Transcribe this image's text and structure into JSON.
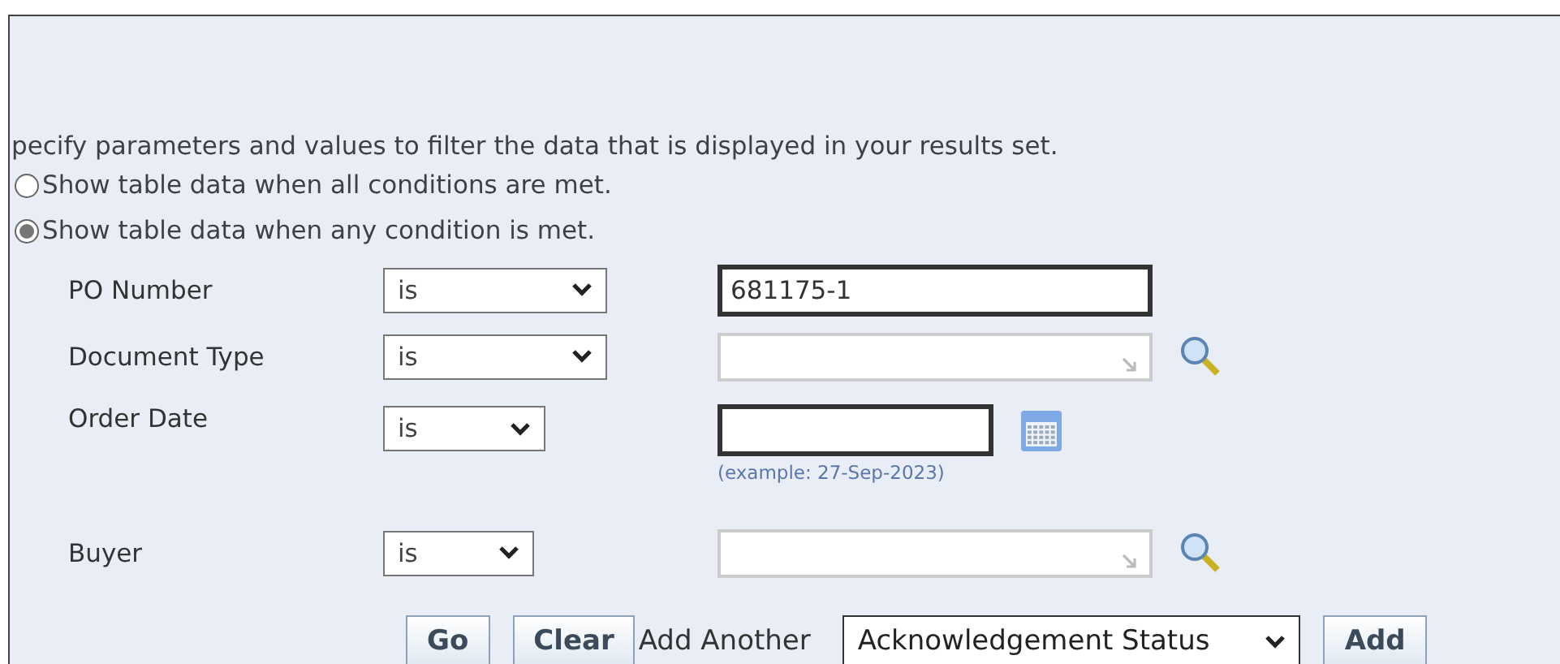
{
  "instructions": "pecify parameters and values to filter the data that is displayed in your results set.",
  "match_options": [
    {
      "label": "Show table data when all conditions are met.",
      "selected": false
    },
    {
      "label": "Show table data when any condition is met.",
      "selected": true
    }
  ],
  "conditions": [
    {
      "label": "PO Number",
      "operator": "is",
      "kind": "text",
      "value": "681175-1",
      "focused": true
    },
    {
      "label": "Document Type",
      "operator": "is",
      "kind": "lov",
      "focused": false
    },
    {
      "label": "Order Date",
      "operator": "is",
      "kind": "date",
      "focused": true,
      "hint": "(example: 27-Sep-2023)"
    },
    {
      "label": "Buyer",
      "operator": "is",
      "kind": "lov",
      "focused": false
    }
  ],
  "buttons": [
    "Go",
    "Clear"
  ],
  "add_another": {
    "label": "Add Another",
    "field": "Acknowledgement Status",
    "button": "Add"
  }
}
